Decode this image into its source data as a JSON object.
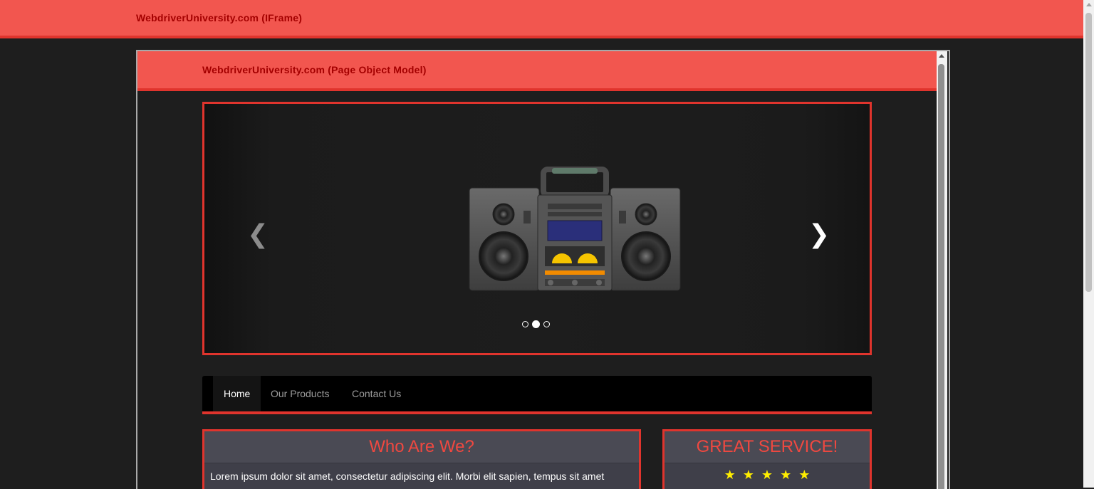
{
  "outer": {
    "title": "WebdriverUniversity.com (IFrame)"
  },
  "iframe": {
    "title": "WebdriverUniversity.com (Page Object Model)",
    "carousel": {
      "prev_icon": "chevron-left-icon",
      "next_icon": "chevron-right-icon",
      "slide_image": "boombox-image",
      "slide_count": 3,
      "active_slide": 2
    },
    "nav": {
      "items": [
        {
          "label": "Home",
          "active": true
        },
        {
          "label": "Our Products",
          "active": false
        },
        {
          "label": "Contact Us",
          "active": false
        }
      ]
    },
    "panels": {
      "who": {
        "heading": "Who Are We?",
        "body": "Lorem ipsum dolor sit amet, consectetur adipiscing elit. Morbi elit sapien, tempus sit amet"
      },
      "service": {
        "heading": "GREAT SERVICE!",
        "stars": "★★★★★",
        "rating": 5
      }
    }
  },
  "colors": {
    "header_bg": "#f2564f",
    "header_border": "#e0342d",
    "header_text": "#a40000",
    "page_bg": "#1e1e1e",
    "panel_heading_text": "#f04840",
    "star": "#ffee00"
  }
}
